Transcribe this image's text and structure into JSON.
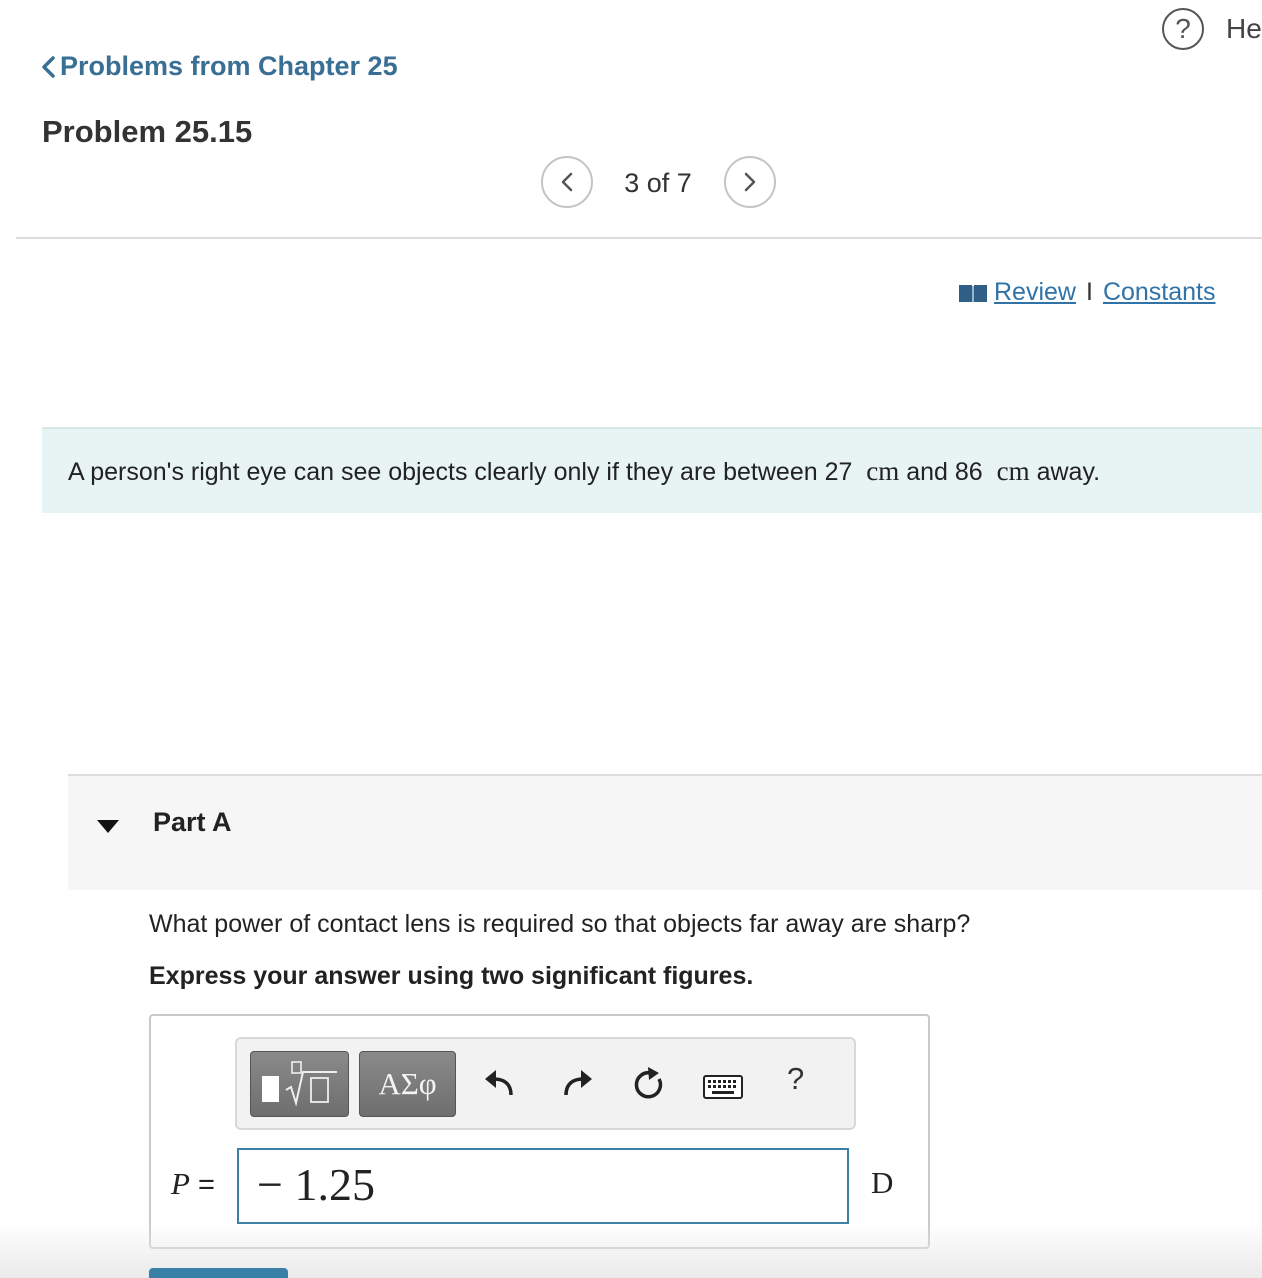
{
  "header": {
    "help_icon_glyph": "?",
    "help_label": "He",
    "back_link": "Problems from Chapter 25",
    "problem_title": "Problem 25.15"
  },
  "pager": {
    "text": "3 of 7"
  },
  "resources": {
    "review": "Review",
    "separator": "I",
    "constants": "Constants"
  },
  "problem": {
    "text_before": "A person's right eye can see objects clearly only if they are between 27",
    "unit1": "cm",
    "text_middle": "and 86",
    "unit2": "cm",
    "text_after": "away."
  },
  "part": {
    "title": "Part A",
    "question": "What power of contact lens is required so that objects far away are sharp?",
    "instruction": "Express your answer using two significant figures."
  },
  "answer": {
    "toolbar": {
      "greek_label": "ΑΣφ",
      "help_label": "?"
    },
    "variable": "P",
    "equals": "=",
    "value": "− 1.25",
    "unit": "D"
  },
  "colors": {
    "link": "#3a6f94",
    "banner_bg": "#e8f4f4",
    "input_border": "#3a7fa8"
  }
}
